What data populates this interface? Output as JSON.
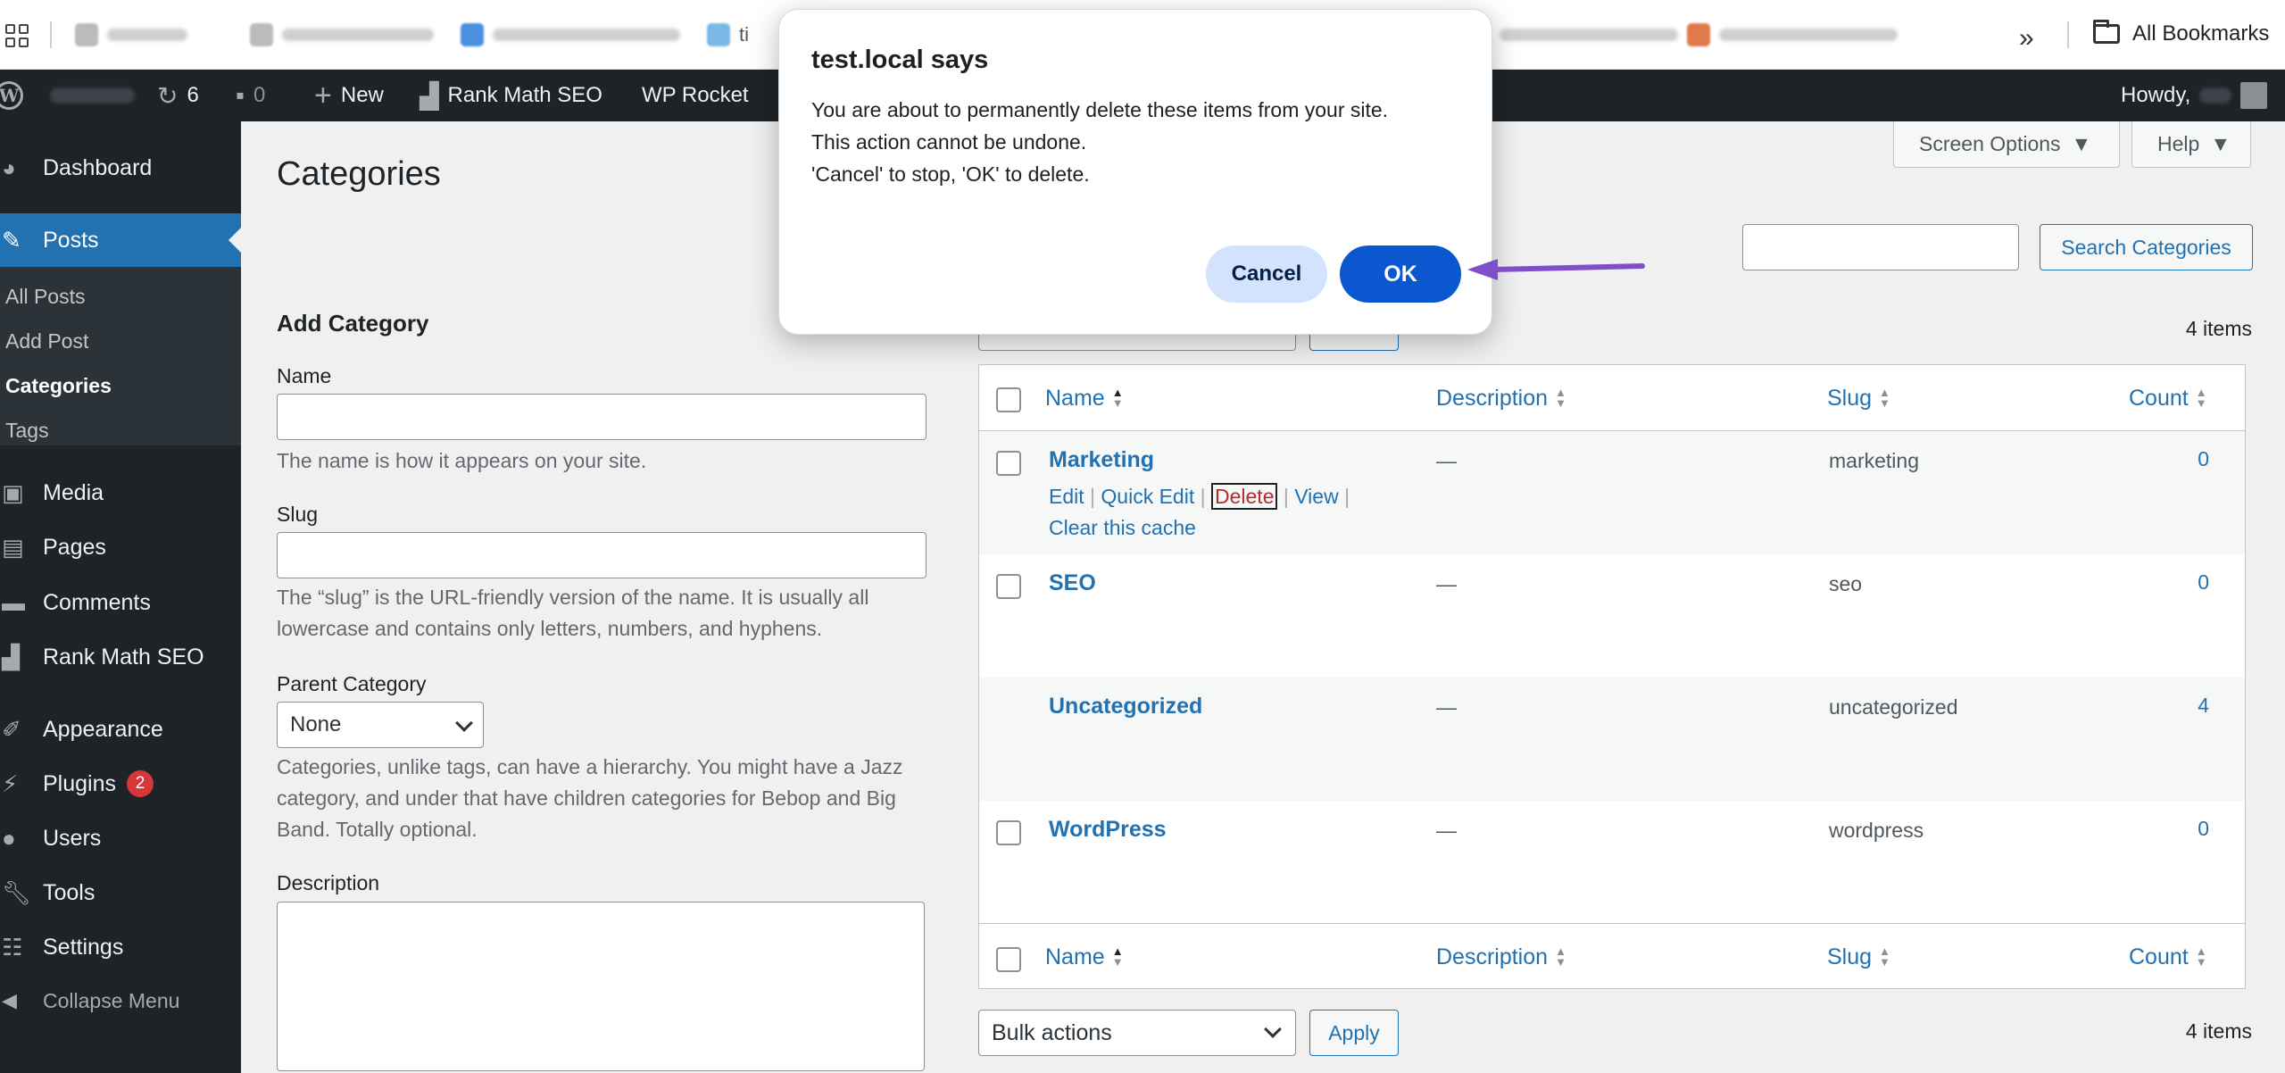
{
  "browser": {
    "bookmarks_partial": "ti",
    "all_bookmarks": "All Bookmarks"
  },
  "adminbar": {
    "updates_count": "6",
    "comments_count": "0",
    "new_label": "New",
    "rankmath_label": "Rank Math SEO",
    "wprocket_label": "WP Rocket",
    "howdy": "Howdy,"
  },
  "sidebar": {
    "dashboard": "Dashboard",
    "posts": "Posts",
    "submenu": [
      "All Posts",
      "Add Post",
      "Categories",
      "Tags"
    ],
    "media": "Media",
    "pages": "Pages",
    "comments": "Comments",
    "rankmath": "Rank Math SEO",
    "appearance": "Appearance",
    "plugins": "Plugins",
    "plugins_badge": "2",
    "users": "Users",
    "tools": "Tools",
    "settings": "Settings",
    "collapse": "Collapse Menu"
  },
  "header": {
    "title": "Categories",
    "screen_options": "Screen Options",
    "help": "Help",
    "search_button": "Search Categories"
  },
  "form": {
    "heading": "Add Category",
    "name_label": "Name",
    "name_help": "The name is how it appears on your site.",
    "slug_label": "Slug",
    "slug_help": "The “slug” is the URL-friendly version of the name. It is usually all lowercase and contains only letters, numbers, and hyphens.",
    "parent_label": "Parent Category",
    "parent_value": "None",
    "parent_help": "Categories, unlike tags, can have a hierarchy. You might have a Jazz category, and under that have children categories for Bebop and Big Band. Totally optional.",
    "description_label": "Description"
  },
  "table": {
    "items_count": "4 items",
    "columns": {
      "name": "Name",
      "description": "Description",
      "slug": "Slug",
      "count": "Count"
    },
    "rows": [
      {
        "name": "Marketing",
        "description": "—",
        "slug": "marketing",
        "count": "0"
      },
      {
        "name": "SEO",
        "description": "—",
        "slug": "seo",
        "count": "0"
      },
      {
        "name": "Uncategorized",
        "description": "—",
        "slug": "uncategorized",
        "count": "4"
      },
      {
        "name": "WordPress",
        "description": "—",
        "slug": "wordpress",
        "count": "0"
      }
    ],
    "row_actions": {
      "edit": "Edit",
      "quick_edit": "Quick Edit",
      "delete": "Delete",
      "view": "View",
      "clear_cache": "Clear this cache"
    },
    "bulk_actions": "Bulk actions",
    "apply": "Apply"
  },
  "dialog": {
    "title": "test.local says",
    "line1": "You are about to permanently delete these items from your site.",
    "line2": "This action cannot be undone.",
    "line3": "'Cancel' to stop, 'OK' to delete.",
    "cancel": "Cancel",
    "ok": "OK"
  },
  "colors": {
    "wp_blue": "#2271b1",
    "admin_dark": "#1d2327",
    "dialog_ok": "#0b57d0",
    "arrow": "#7e4fc8"
  }
}
